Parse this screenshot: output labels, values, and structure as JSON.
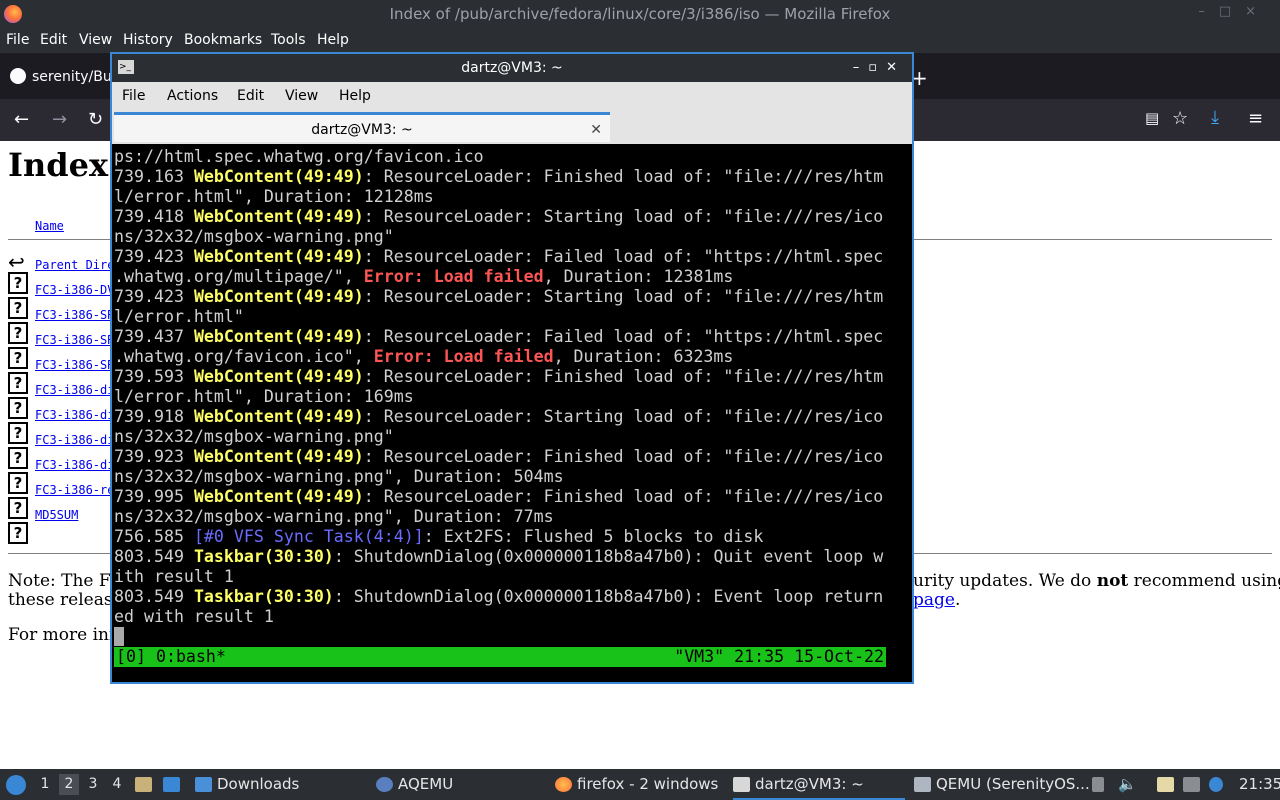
{
  "firefox": {
    "window_title": "Index of /pub/archive/fedora/linux/core/3/i386/iso — Mozilla Firefox",
    "menu": [
      "File",
      "Edit",
      "View",
      "History",
      "Bookmarks",
      "Tools",
      "Help"
    ],
    "tab_label": "serenity/Bui",
    "page": {
      "heading": "Index",
      "column_name": "Name",
      "entries": [
        "Parent Direc",
        "FC3-i386-DV",
        "FC3-i386-SR",
        "FC3-i386-SR",
        "FC3-i386-SR",
        "FC3-i386-di",
        "FC3-i386-di",
        "FC3-i386-di",
        "FC3-i386-di",
        "FC3-i386-re",
        "MD5SUM"
      ],
      "note_left_1": "Note: The Fe",
      "note_right_1a": "urity updates. We do ",
      "note_right_1b": "not",
      "note_right_1c": " recommend using",
      "note_left_2": "these release",
      "note_right_2_link": "page",
      "note_right_2_end": ".",
      "more_info": "For more inf"
    }
  },
  "terminal": {
    "title": "dartz@VM3: ~",
    "menu": [
      "File",
      "Actions",
      "Edit",
      "View",
      "Help"
    ],
    "tab_label": "dartz@VM3: ~",
    "tmux_left": "[0] 0:bash*",
    "tmux_right": "\"VM3\" 21:35 15-Oct-22"
  },
  "taskbar": {
    "desktops": [
      "1",
      "2",
      "3",
      "4"
    ],
    "items": [
      "Downloads",
      "AQEMU",
      "firefox - 2 windows",
      "dartz@VM3: ~",
      "QEMU (SerenityOS..."
    ],
    "clock": "21:35"
  },
  "colors": {
    "accent": "#3a87d6",
    "tmux_status": "#19c219",
    "log_process": "#ffff66",
    "log_error": "#ff5555",
    "log_vfs": "#6b6bff"
  }
}
